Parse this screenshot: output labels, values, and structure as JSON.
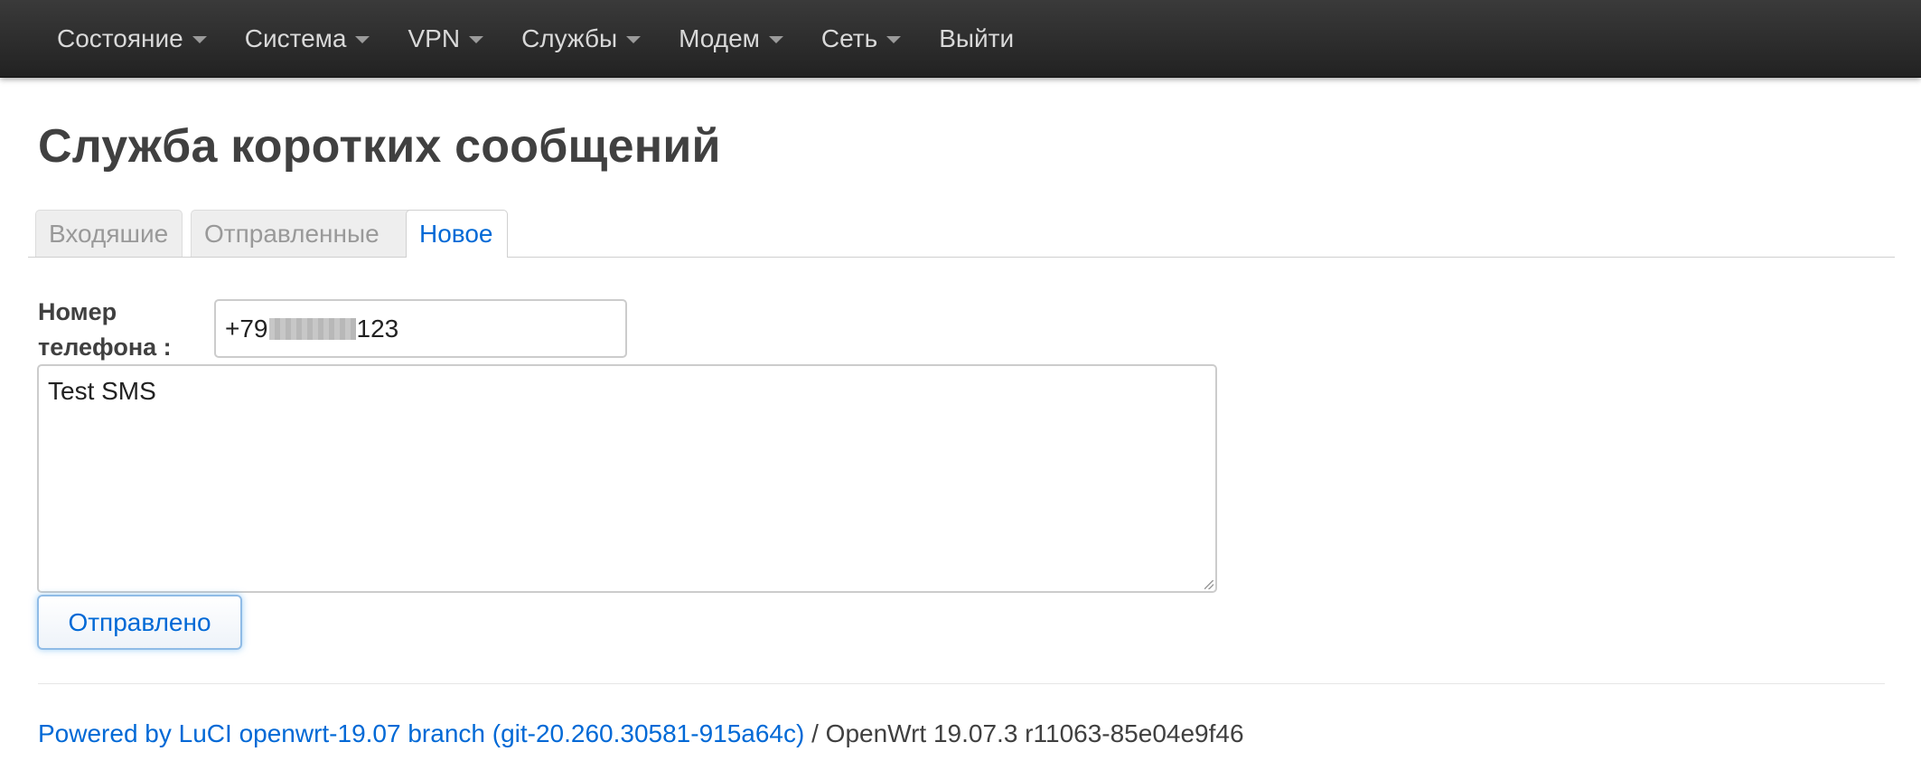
{
  "nav": {
    "items": [
      {
        "label": "Состояние",
        "has_dropdown": true
      },
      {
        "label": "Система",
        "has_dropdown": true
      },
      {
        "label": "VPN",
        "has_dropdown": true
      },
      {
        "label": "Службы",
        "has_dropdown": true
      },
      {
        "label": "Модем",
        "has_dropdown": true
      },
      {
        "label": "Сеть",
        "has_dropdown": true
      },
      {
        "label": "Выйти",
        "has_dropdown": false
      }
    ]
  },
  "page": {
    "title": "Служба коротких сообщений"
  },
  "tabs": [
    {
      "label": "Входяшие",
      "active": false
    },
    {
      "label": "Отправленные",
      "active": false
    },
    {
      "label": "Новое",
      "active": true
    }
  ],
  "form": {
    "phone_label_line1": "Номер",
    "phone_label_line2": "телефона :",
    "phone_prefix": "+79",
    "phone_suffix": "123",
    "phone_redacted": true,
    "message_value": "Test SMS",
    "send_label": "Отправлено"
  },
  "footer": {
    "link_text": "Powered by LuCI openwrt-19.07 branch (git-20.260.30581-915a64c)",
    "separator": " / ",
    "version_text": "OpenWrt 19.07.3 r11063-85e04e9f46"
  },
  "colors": {
    "navbar_bg": "#222222",
    "nav_text": "#d9d9d9",
    "link": "#0069d6",
    "text": "#404040",
    "inactive_tab_bg": "#eeeeee"
  }
}
